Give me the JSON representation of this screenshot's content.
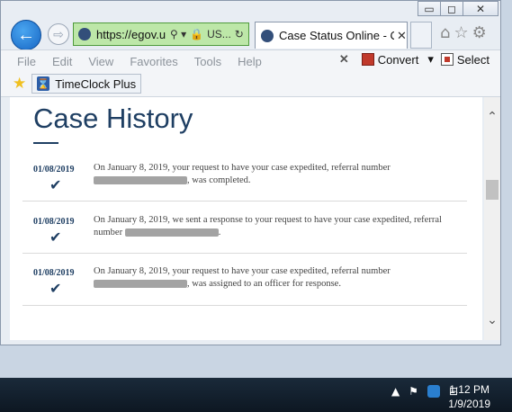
{
  "window": {
    "controls": {
      "minimize": "▭",
      "restore": "◻",
      "close": "✕"
    }
  },
  "nav": {
    "back_icon": "←",
    "forward_icon": "⇨",
    "address": {
      "url": "https://egov.u",
      "search_symbol": "⚲ ▾",
      "lock_symbol": "🔒",
      "site_label": "US...",
      "refresh_symbol": "↻"
    },
    "tab": {
      "title": "Case Status Online - C...",
      "close": "✕"
    },
    "icons": {
      "home": "⌂",
      "favorites": "☆",
      "settings": "⚙"
    }
  },
  "menubar": {
    "items": [
      "File",
      "Edit",
      "View",
      "Favorites",
      "Tools",
      "Help"
    ],
    "close_x": "✕",
    "convert_label": "Convert",
    "convert_arrow": "▾",
    "select_label": "Select"
  },
  "favbar": {
    "star": "★",
    "timeclock_label": "TimeClock Plus"
  },
  "page": {
    "heading": "Case History",
    "entries": [
      {
        "date": "01/08/2019",
        "check": "✔",
        "text_a": "On January 8, 2019, your request to have your case expedited, referral number",
        "text_b": ", was completed."
      },
      {
        "date": "01/08/2019",
        "check": "✔",
        "text_a": "On January 8, 2019, we sent a response to your request to have your case expedited, referral number",
        "text_b": "."
      },
      {
        "date": "01/08/2019",
        "check": "✔",
        "text_a": "On January 8, 2019, your request to have your case expedited, referral number",
        "text_b": ", was assigned to an officer for response."
      }
    ]
  },
  "scrollbar": {
    "up": "⌃",
    "down": "⌄"
  },
  "taskbar": {
    "tray": {
      "up_arrow": "▲",
      "flag": "⚑",
      "network": "⊟"
    },
    "time": "1:12 PM",
    "date": "1/9/2019"
  }
}
